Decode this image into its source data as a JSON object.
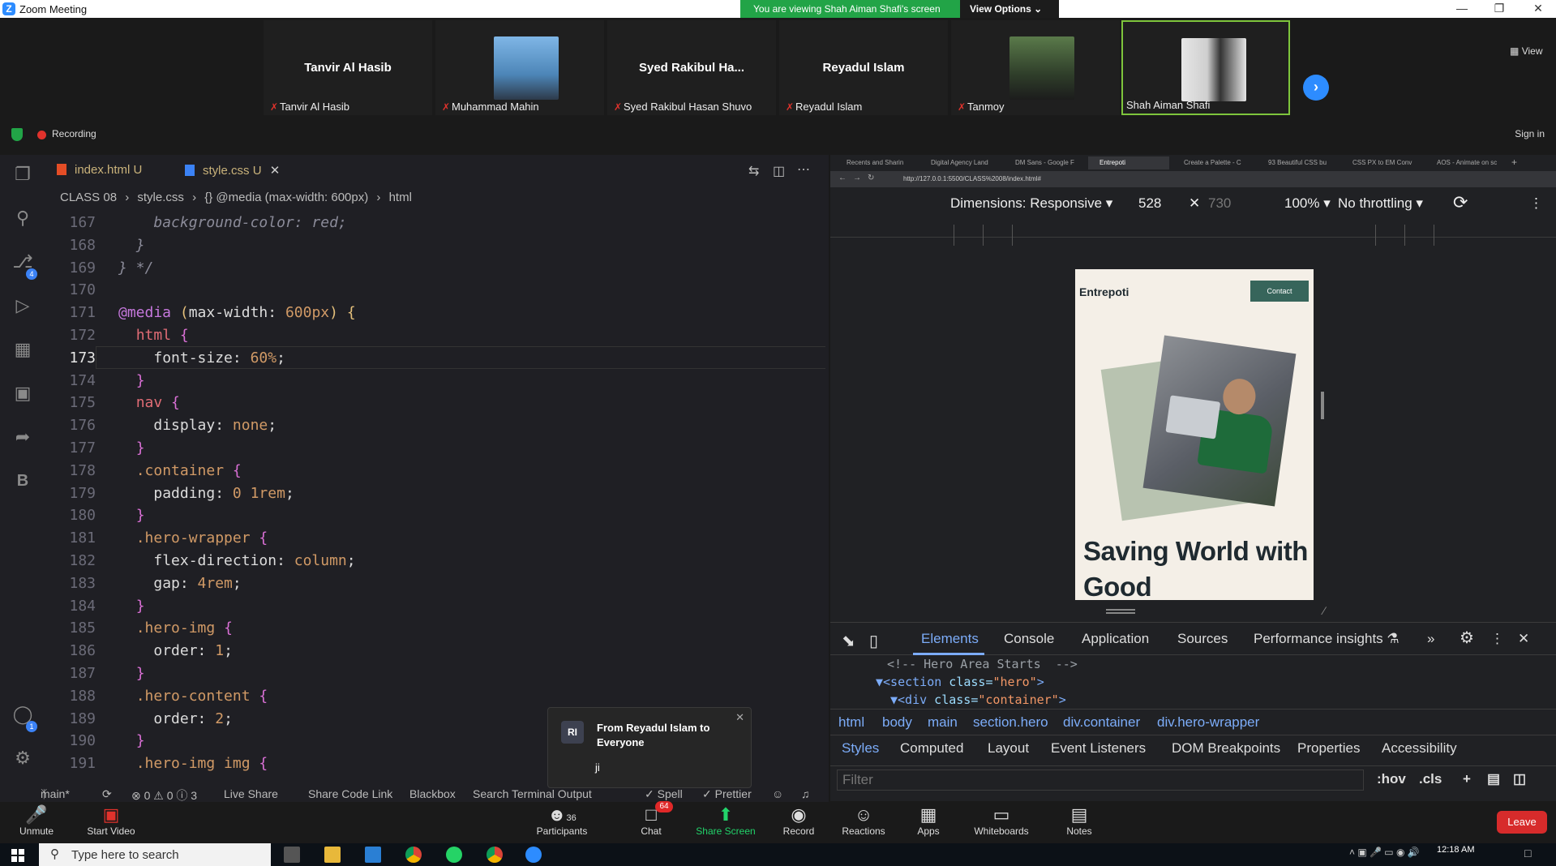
{
  "zoom": {
    "window_title": "Zoom Meeting",
    "share_banner": "You are viewing Shah Aiman Shafi's screen",
    "view_options": "View Options",
    "view_label": "View",
    "recording_label": "Recording",
    "sign_in": "Sign in",
    "participants": [
      {
        "name": "Tanvir Al Hasib",
        "display": "Tanvir Al Hasib",
        "has_video": false
      },
      {
        "name": "Muhammad Mahin",
        "display": "",
        "has_video": true
      },
      {
        "name": "Syed Rakibul Hasan Shuvo",
        "display": "Syed  Rakibul  Ha...",
        "has_video": false
      },
      {
        "name": "Reyadul Islam",
        "display": "Reyadul Islam",
        "has_video": false
      },
      {
        "name": "Tanmoy",
        "display": "",
        "has_video": true
      },
      {
        "name": "Shah Aiman Shafi",
        "display": "",
        "has_video": true,
        "active": true
      }
    ],
    "toolbar": {
      "unmute": "Unmute",
      "start_video": "Start Video",
      "participants": "Participants",
      "participants_count": "36",
      "chat": "Chat",
      "chat_badge": "64",
      "share_screen": "Share Screen",
      "record": "Record",
      "reactions": "Reactions",
      "apps": "Apps",
      "whiteboards": "Whiteboards",
      "notes": "Notes",
      "leave": "Leave"
    },
    "chat_toast": {
      "avatar": "RI",
      "from": "From Reyadul Islam to Everyone",
      "message": "ji"
    }
  },
  "vscode": {
    "tabs": [
      {
        "label": "index.html",
        "status": "U",
        "type": "html"
      },
      {
        "label": "style.css",
        "status": "U",
        "type": "css",
        "active": true
      }
    ],
    "breadcrumb": [
      "CLASS 08",
      "style.css",
      "{} @media (max-width: 600px)",
      "html"
    ],
    "status_bar": {
      "branch": "main*",
      "problems": "⊗ 0 ⚠ 0 ⓘ 3",
      "live_share": "Live Share",
      "share_code": "Share Code Link",
      "blackbox": "Blackbox",
      "search_terminal": "Search Terminal Output",
      "spell": "✓ Spell",
      "prettier": "✓ Prettier"
    },
    "badges": {
      "source_control": "4",
      "accounts": "1"
    },
    "code_lines": [
      {
        "n": "167",
        "html": "    <span class=\"cm\">background-color: red;</span>"
      },
      {
        "n": "168",
        "html": "  <span class=\"cm\">}</span>"
      },
      {
        "n": "169",
        "html": "<span class=\"cm\">} */</span>"
      },
      {
        "n": "170",
        "html": ""
      },
      {
        "n": "171",
        "html": "<span class=\"kw\">@media</span> <span class=\"br1\">(</span><span class=\"prop\">max-width: </span><span class=\"val\">600px</span><span class=\"br1\">)</span> <span class=\"br1\">{</span>"
      },
      {
        "n": "172",
        "html": "  <span class=\"sel\">html</span> <span class=\"br2\">{</span>"
      },
      {
        "n": "173",
        "html": "    <span class=\"prop\">font-size: </span><span class=\"val\">60%</span>;"
      },
      {
        "n": "174",
        "html": "  <span class=\"br2\">}</span>"
      },
      {
        "n": "175",
        "html": "  <span class=\"sel\">nav</span> <span class=\"br2\">{</span>"
      },
      {
        "n": "176",
        "html": "    <span class=\"prop\">display: </span><span class=\"val\">none</span>;"
      },
      {
        "n": "177",
        "html": "  <span class=\"br2\">}</span>"
      },
      {
        "n": "178",
        "html": "  <span class=\"val\">.container</span> <span class=\"br2\">{</span>"
      },
      {
        "n": "179",
        "html": "    <span class=\"prop\">padding: </span><span class=\"val\">0 1rem</span>;"
      },
      {
        "n": "180",
        "html": "  <span class=\"br2\">}</span>"
      },
      {
        "n": "181",
        "html": "  <span class=\"val\">.hero-wrapper</span> <span class=\"br2\">{</span>"
      },
      {
        "n": "182",
        "html": "    <span class=\"prop\">flex-direction: </span><span class=\"val\">column</span>;"
      },
      {
        "n": "183",
        "html": "    <span class=\"prop\">gap: </span><span class=\"val\">4rem</span>;"
      },
      {
        "n": "184",
        "html": "  <span class=\"br2\">}</span>"
      },
      {
        "n": "185",
        "html": "  <span class=\"val\">.hero-img</span> <span class=\"br2\">{</span>"
      },
      {
        "n": "186",
        "html": "    <span class=\"prop\">order: </span><span class=\"val\">1</span>;"
      },
      {
        "n": "187",
        "html": "  <span class=\"br2\">}</span>"
      },
      {
        "n": "188",
        "html": "  <span class=\"val\">.hero-content</span> <span class=\"br2\">{</span>"
      },
      {
        "n": "189",
        "html": "    <span class=\"prop\">order: </span><span class=\"val\">2</span>;"
      },
      {
        "n": "190",
        "html": "  <span class=\"br2\">}</span>"
      },
      {
        "n": "191",
        "html": "  <span class=\"val\">.hero-img img</span> <span class=\"br2\">{</span>"
      }
    ],
    "current_line": "173"
  },
  "browser": {
    "tabs": [
      "Recents and Sharin",
      "Digital Agency Land",
      "DM Sans - Google F",
      "Entrepoti",
      "Create a Palette - C",
      "93 Beautiful CSS bu",
      "CSS PX to EM Conv",
      "AOS - Animate on sc"
    ],
    "active_tab": "Entrepoti",
    "url": "http://127.0.0.1:5500/CLASS%2008/index.html#",
    "device_toolbar": {
      "dimensions": "Dimensions: Responsive ▾",
      "width": "528",
      "times": "✕",
      "height": "730",
      "zoom": "100% ▾",
      "throttling": "No throttling ▾"
    },
    "page": {
      "brand": "Entrepoti",
      "contact": "Contact",
      "hero_title": "Saving World with Good"
    },
    "devtools": {
      "tabs": [
        "Elements",
        "Console",
        "Application",
        "Sources",
        "Performance insights ⚗"
      ],
      "more": "»",
      "dom": {
        "comment": "<!-- Hero Area Starts  -->",
        "section_tag": "▼<section",
        "section_attr": " class=",
        "section_val": "\"hero\"",
        "div_tag": "▼<div",
        "div_attr": " class=",
        "div_val": "\"container\""
      },
      "crumbs": [
        "html",
        "body",
        "main",
        "section.hero",
        "div.container",
        "div.hero-wrapper"
      ],
      "style_tabs": [
        "Styles",
        "Computed",
        "Layout",
        "Event Listeners",
        "DOM Breakpoints",
        "Properties",
        "Accessibility"
      ],
      "filter_placeholder": "Filter",
      "hov": ":hov",
      "cls": ".cls"
    }
  },
  "taskbar": {
    "search_placeholder": "Type here to search",
    "time": "12:18 AM"
  },
  "colors": {
    "zoom_green": "#22a447",
    "zoom_blue": "#2d8cff",
    "leave_red": "#d72b2b",
    "devtools_accent": "#7cacf8",
    "page_bg": "#f4efe7",
    "contact_btn": "#37655b"
  }
}
